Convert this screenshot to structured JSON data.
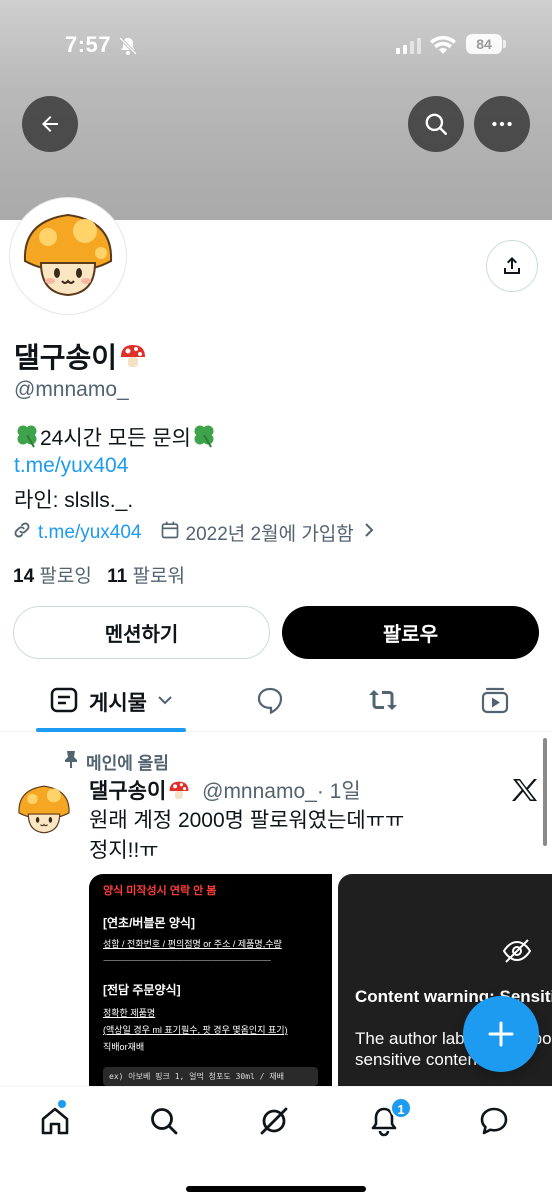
{
  "status_bar": {
    "time": "7:57",
    "battery": "84"
  },
  "profile": {
    "display_name": "댈구송이",
    "handle": "@mnnamo_",
    "bio": {
      "line1": "24시간 모든 문의",
      "link": "t.me/yux404",
      "line3": "라인: slslls._."
    },
    "website": "t.me/yux404",
    "joined": "2022년 2월에 가입함",
    "following_count": "14",
    "following_label": "팔로잉",
    "followers_count": "11",
    "followers_label": "팔로워"
  },
  "actions": {
    "mention": "멘션하기",
    "follow": "팔로우"
  },
  "tabs": {
    "posts": "게시물"
  },
  "pinned_post": {
    "pinned_label": "메인에 올림",
    "author_name": "댈구송이",
    "author_handle": "@mnnamo_",
    "time": "· 1일",
    "text_line1": "원래 계정 2000명 팔로워였는데ㅠㅠ",
    "text_line2": "정지!!ㅠ",
    "media1": {
      "warning": "양식 미작성시 연락 안 봄",
      "heading1": "[연초/버블몬 양식]",
      "fields1": "성함 / 전화번호 / 편의점명 or 주소 / 제품명,수량",
      "dashes": "ㅡㅡㅡㅡㅡㅡㅡㅡㅡㅡㅡㅡㅡㅡㅡㅡㅡㅡㅡㅡㅡㅡㅡ",
      "heading2": "[전담 주문양식]",
      "fields2a": "정확한 제품명",
      "fields2b": "(액상일 경우 ml 표기필수, 팟 경우 몇옴인지 표기)",
      "fields2c": "직배or재배",
      "example": "ex) 아보베 핑크 1, 얼먹 청포도 30ml / 재배"
    },
    "media2": {
      "cw_title": "Content warning: Sensitive",
      "cw_body": "The author labeled this post as sensitive content."
    }
  },
  "nav": {
    "notifications_badge": "1"
  },
  "colors": {
    "accent": "#1d9bf0",
    "text": "#0f1419",
    "muted": "#536471"
  }
}
